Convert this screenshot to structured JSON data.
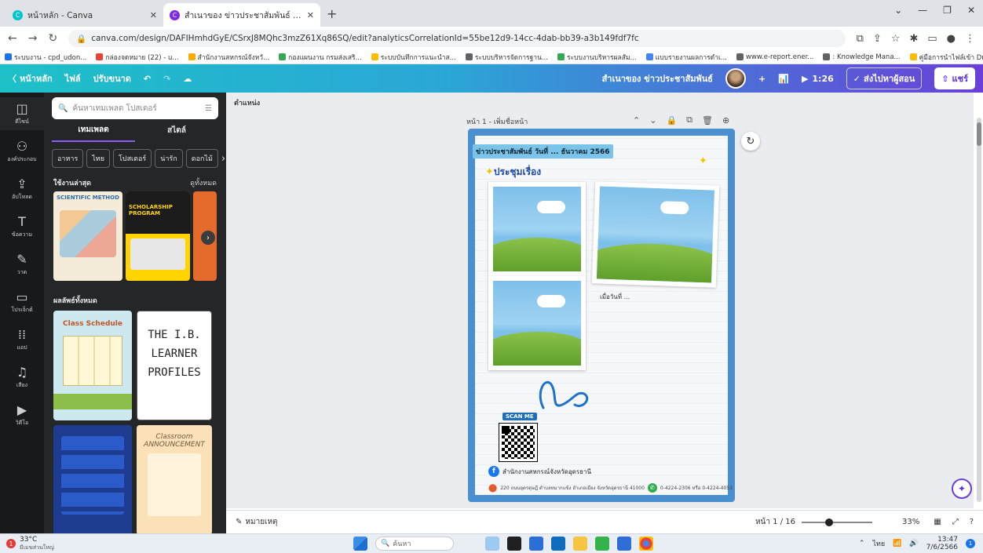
{
  "browser": {
    "tabs": [
      {
        "label": "หน้าหลัก - Canva",
        "favicon_color": "#00c4cc"
      },
      {
        "label": "สำเนาของ ข่าวประชาสัมพันธ์ - โปสเตอร์",
        "favicon_color": "#7d2ae8"
      }
    ],
    "new_tab": "+",
    "url": "canva.com/design/DAFIHmhdGyE/CSrxJ8MQhc3mzZ61Xq86SQ/edit?analyticsCorrelationId=55be12d9-14cc-4dab-bb39-a3b149fdf7fc",
    "bookmarks": [
      {
        "label": "ระบบงาน - cpd_udon...",
        "color": "#1a73e8"
      },
      {
        "label": "กล่องจดหมาย (22) - u...",
        "color": "#ea4335"
      },
      {
        "label": "สำนักงานสหกรณ์จังหวั...",
        "color": "#f9ab00"
      },
      {
        "label": "กองแผนงาน กรมส่งเสริ...",
        "color": "#34a853"
      },
      {
        "label": "ระบบบันทึกการแนะนำส...",
        "color": "#fbbc04"
      },
      {
        "label": "ระบบบริหารจัดการฐาน...",
        "color": "#5f6368"
      },
      {
        "label": "ระบบงานบริหารผลสัม...",
        "color": "#34a853"
      },
      {
        "label": "แบบรายงานผลการดำเ...",
        "color": "#4285f4"
      },
      {
        "label": "www.e-report.ener...",
        "color": "#5f6368"
      },
      {
        "label": ": Knowledge Mana...",
        "color": "#5f6368"
      },
      {
        "label": "คู่มือการนำไฟล์เข้า Dri...",
        "color": "#fbbc04"
      },
      {
        "label": "MOU64_1 - Google...",
        "color": "#34a853"
      }
    ]
  },
  "header": {
    "home": "หน้าหลัก",
    "file": "ไฟล์",
    "resize": "ปรับขนาด",
    "doc_title": "สำเนาของ ข่าวประชาสัมพันธ์",
    "present_time": "1:26",
    "send_label": "ส่งไปหาผู้สอน",
    "share": "แชร์"
  },
  "rail": [
    {
      "label": "ดีไซน์",
      "icon": "design-icon"
    },
    {
      "label": "องค์ประกอบ",
      "icon": "elements-icon"
    },
    {
      "label": "อัปโหลด",
      "icon": "upload-icon"
    },
    {
      "label": "ข้อความ",
      "icon": "text-icon"
    },
    {
      "label": "วาด",
      "icon": "draw-icon"
    },
    {
      "label": "โปรเจ็กต์",
      "icon": "folder-icon"
    },
    {
      "label": "แอป",
      "icon": "apps-icon"
    },
    {
      "label": "เสียง",
      "icon": "audio-icon"
    },
    {
      "label": "วิดีโอ",
      "icon": "video-icon"
    }
  ],
  "panel": {
    "search_placeholder": "ค้นหาเทมเพลต โปสเตอร์",
    "tab_templates": "เทมเพลต",
    "tab_styles": "สไตล์",
    "chips": [
      "อาหาร",
      "ไทย",
      "โปสเตอร์",
      "น่ารัก",
      "ดอกไม้"
    ],
    "recent_heading": "ใช้งานล่าสุด",
    "see_all": "ดูทั้งหมด",
    "recent": [
      {
        "title": "SCIENTIFIC METHOD"
      },
      {
        "title": "SCHOLARSHIP PROGRAM"
      }
    ],
    "all_results": "ผลลัพธ์ทั้งหมด",
    "results": [
      {
        "title": "Class Schedule"
      },
      {
        "title": "THE I.B. LEARNER PROFILES"
      },
      {
        "title": ""
      },
      {
        "title": "Classroom ANNOUNCEMENT"
      }
    ]
  },
  "workspace": {
    "position": "ตำแหน่ง",
    "page_label": "หน้า 1 - เพิ่มชื่อหน้า",
    "design": {
      "news_title": "ข่าวประชาสัมพันธ์ วันที่ ... ธันวาคม 2566",
      "subject": "ประชุมเรื่อง",
      "date_caption": "เมื่อวันที่ ...",
      "scan_me": "SCAN ME",
      "office": "สำนักงานสหกรณ์จังหวัดอุดรธานี",
      "address": "220 ถนนอุดรดุษฎี ตำบลหมากแข้ง อำเภอเมือง จังหวัดอุดรธานี 41000",
      "phone": "0-4224-2306 หรือ 0-4224-4053"
    }
  },
  "status": {
    "notes": "หมายเหตุ",
    "page_indicator": "หน้า 1 / 16",
    "zoom": "33%",
    "zoom_fraction": 0.33
  },
  "taskbar": {
    "temperature": "33°C",
    "weather_desc": "มีเมฆส่วนใหญ่",
    "search": "ค้นหา",
    "lang": "ไทย",
    "time": "13:47",
    "date": "7/6/2566",
    "notification_count": "1"
  }
}
